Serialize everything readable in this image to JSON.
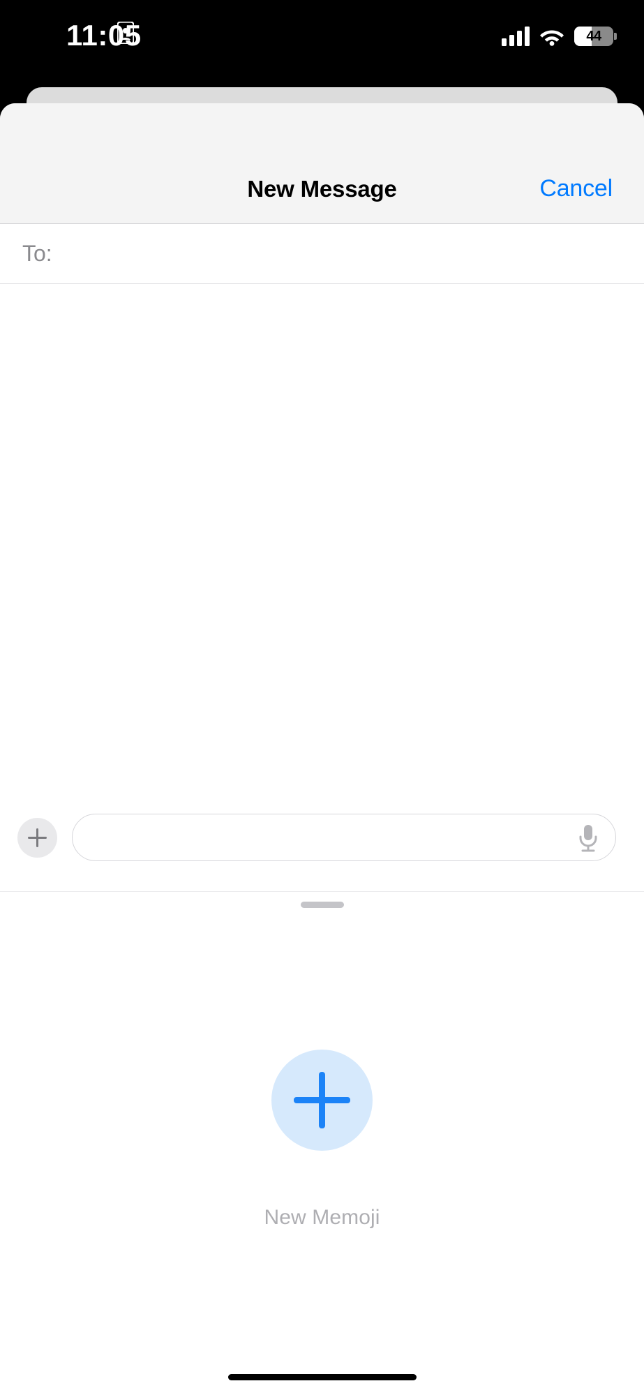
{
  "status_bar": {
    "time": "11:05",
    "contact_icon": "contact-card-icon",
    "cellular_icon": "cellular-signal-icon",
    "cellular_bars": 4,
    "wifi_icon": "wifi-icon",
    "battery_percent": "44",
    "battery_level": 44,
    "battery_icon": "battery-icon"
  },
  "navbar": {
    "title": "New Message",
    "cancel_label": "Cancel"
  },
  "recipients": {
    "to_label": "To:",
    "to_value": "",
    "to_placeholder": ""
  },
  "input_bar": {
    "add_button_icon": "plus-icon",
    "message_value": "",
    "message_placeholder": "",
    "mic_icon": "microphone-icon"
  },
  "grabber": {
    "icon": "drag-handle-icon"
  },
  "memoji_panel": {
    "add_icon": "plus-icon",
    "add_label": "New Memoji"
  },
  "home_indicator": {
    "icon": "home-indicator"
  },
  "colors": {
    "accent_blue": "#007aff",
    "memoji_plus_blue": "#1c83f7",
    "memoji_circle_blue": "#d6e9fc",
    "navbar_bg": "#f4f4f4",
    "back_card": "#dcdcdc",
    "muted_text": "#8a8a8e",
    "memoji_label_text": "#aeaeb2"
  }
}
